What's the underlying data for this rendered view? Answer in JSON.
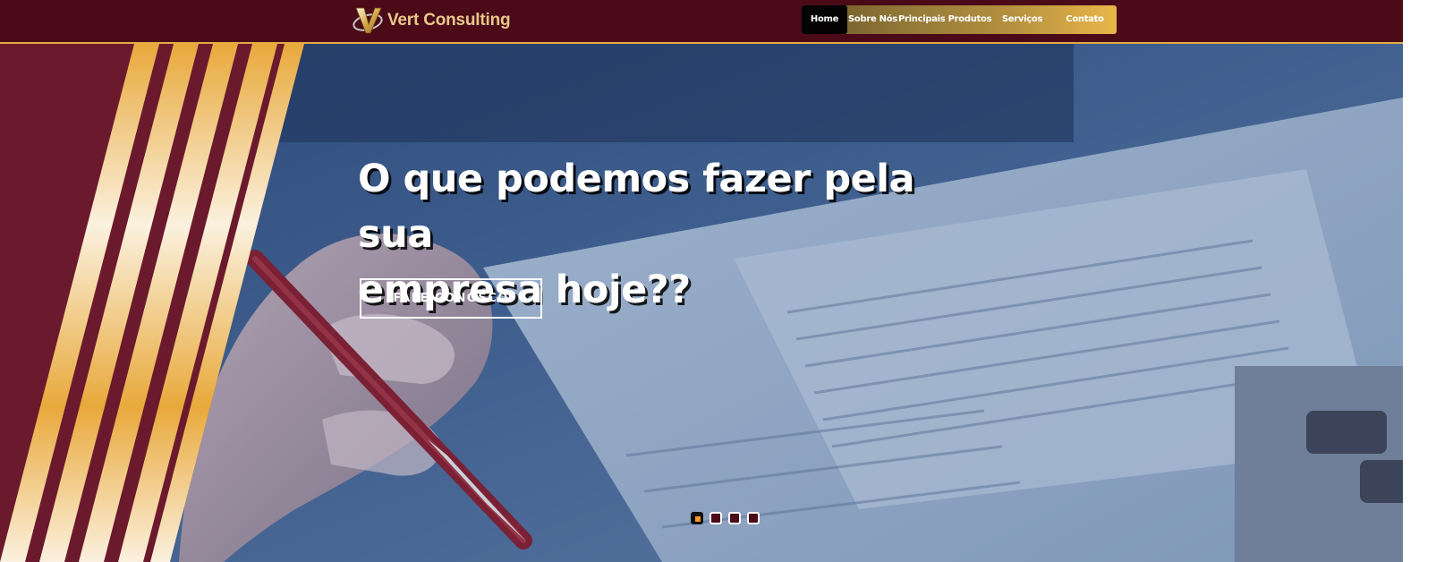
{
  "brand": {
    "name": "Vert Consulting",
    "logo_icon": "v-swoosh-logo"
  },
  "nav": {
    "items": [
      {
        "label": "Home",
        "active": true
      },
      {
        "label": "Sobre Nós",
        "active": false
      },
      {
        "label": "Principais Produtos",
        "active": false
      },
      {
        "label": "Serviços",
        "active": false
      },
      {
        "label": "Contato",
        "active": false
      }
    ]
  },
  "hero": {
    "title_line1": "O que podemos fazer pela sua",
    "title_line2": "empresa hoje??",
    "cta_label": "FALE CONOSCO"
  },
  "carousel": {
    "slide_count": 4,
    "active_index": 0
  },
  "colors": {
    "brand_maroon": "#4a0a18",
    "accent_gold": "#e4ac45",
    "indicator_orange": "#f59a23"
  }
}
